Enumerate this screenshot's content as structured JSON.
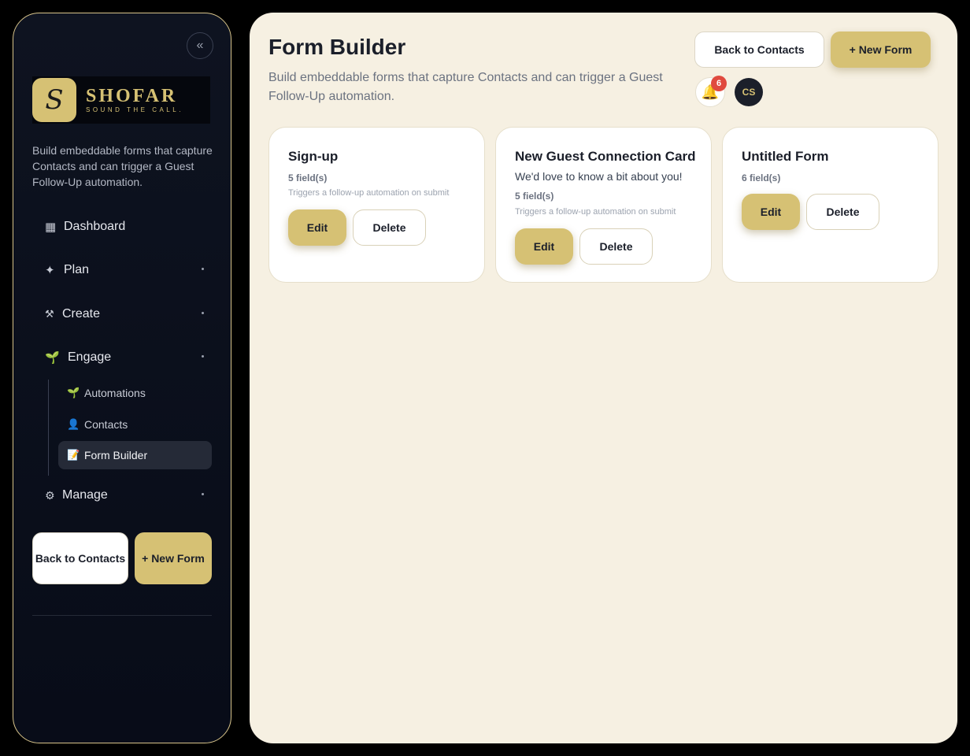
{
  "sidebar": {
    "collapse_glyph": "«",
    "logo": {
      "mark": "S",
      "name": "SHOFAR",
      "tagline": "SOUND THE CALL."
    },
    "description": "Build embeddable forms that capture Contacts and can trigger a Guest Follow-Up automation.",
    "nav": [
      {
        "label": "Dashboard",
        "icon": "▦",
        "icon_name": "grid-icon"
      },
      {
        "label": "Plan",
        "icon": "✦",
        "icon_name": "sparkle-icon"
      },
      {
        "label": "Create",
        "icon": "⚒",
        "icon_name": "tools-icon"
      },
      {
        "label": "Engage",
        "icon": "🌱",
        "icon_name": "seedling-icon"
      },
      {
        "label": "Manage",
        "icon": "⚙",
        "icon_name": "gear-icon"
      }
    ],
    "engage_children": [
      {
        "label": "Automations",
        "icon": "🌱",
        "icon_name": "seedling-icon"
      },
      {
        "label": "Contacts",
        "icon": "👤",
        "icon_name": "person-icon"
      },
      {
        "label": "Form Builder",
        "icon": "📝",
        "icon_name": "memo-icon",
        "active": true
      }
    ],
    "back_button": "Back to Contacts",
    "new_button": "+ New Form"
  },
  "header": {
    "title": "Form Builder",
    "description": "Build embeddable forms that capture Contacts and can trigger a Guest Follow-Up automation.",
    "back_button": "Back to Contacts",
    "new_button": "+ New Form",
    "notifications": {
      "icon": "🔔",
      "count": "6"
    },
    "avatar_initials": "CS"
  },
  "forms": [
    {
      "title": "Sign-up",
      "subtitle": "",
      "fields": "5 field(s)",
      "trigger": "Triggers a follow-up automation on submit",
      "edit": "Edit",
      "delete": "Delete"
    },
    {
      "title": "New Guest Connection Card",
      "subtitle": "We'd love to know a bit about you!",
      "fields": "5 field(s)",
      "trigger": "Triggers a follow-up automation on submit",
      "edit": "Edit",
      "delete": "Delete"
    },
    {
      "title": "Untitled Form",
      "subtitle": "",
      "fields": "6 field(s)",
      "trigger": "",
      "edit": "Edit",
      "delete": "Delete"
    }
  ],
  "colors": {
    "accent_gold": "#d6c174",
    "sidebar_bg": "#0b0f1a",
    "main_bg": "#f6f0e2",
    "badge_red": "#e04a3f"
  }
}
